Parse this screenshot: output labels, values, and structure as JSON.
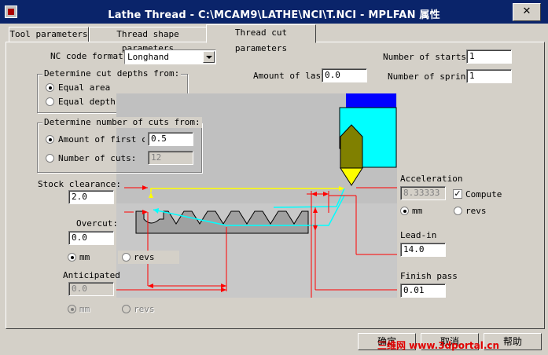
{
  "window": {
    "title": "Lathe Thread - C:\\MCAM9\\LATHE\\NCI\\T.NCI - MPLFAN 属性",
    "close_glyph": "✕"
  },
  "tabs": [
    {
      "label": "Tool parameters",
      "active": false
    },
    {
      "label": "Thread shape parameters",
      "active": false
    },
    {
      "label": "Thread cut parameters",
      "active": true
    }
  ],
  "nc_code": {
    "label": "NC code format:",
    "value": "Longhand"
  },
  "number_of_starts": {
    "label": "Number of starts:",
    "value": "1"
  },
  "amount_of_last": {
    "label": "Amount of last",
    "value": "0.0"
  },
  "number_of_spring": {
    "label": "Number of spring",
    "value": "1"
  },
  "cut_depths": {
    "title": "Determine cut depths from:",
    "equal_area": "Equal area",
    "equal_depths": "Equal depths"
  },
  "num_cuts": {
    "title": "Determine number of cuts from:",
    "amount_first_label": "Amount of first c",
    "amount_first_value": "0.5",
    "number_cuts_label": "Number of cuts:",
    "number_cuts_value": "12"
  },
  "stock_clearance": {
    "label": "Stock clearance:",
    "value": "2.0"
  },
  "overcut": {
    "label": "Overcut:",
    "value": "0.0"
  },
  "units_left": {
    "mm": "mm",
    "revs": "revs"
  },
  "anticipated": {
    "label": "Anticipated",
    "value": "0.0",
    "mm": "mm",
    "revs": "revs"
  },
  "acceleration": {
    "label": "Acceleration",
    "value": "8.33333",
    "compute_label": "Compute",
    "check_glyph": "✓",
    "mm": "mm",
    "revs": "revs"
  },
  "lead_in": {
    "label": "Lead-in",
    "value": "14.0"
  },
  "finish_pass": {
    "label": "Finish pass",
    "value": "0.01"
  },
  "buttons": {
    "ok": "确定",
    "cancel": "取消",
    "help": "帮助"
  },
  "watermark": "三维网 www.3dportal.cn",
  "colors": {
    "tool_holder": "#00ffff",
    "tool_tip": "#ffff00",
    "tool_top": "#0000ff",
    "path_yellow": "#ffff00",
    "path_cyan": "#00ffff",
    "dimension": "#ff0000",
    "part": "#a0a0a0"
  }
}
